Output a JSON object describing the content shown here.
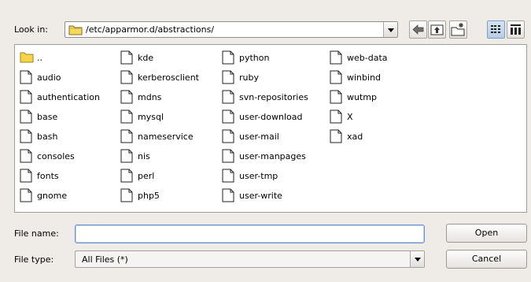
{
  "look_in": {
    "label": "Look in:",
    "path": "/etc/apparmor.d/abstractions/"
  },
  "toolbar": {
    "back": "back-arrow-icon",
    "up": "up-folder-icon",
    "new_folder": "new-folder-icon",
    "list_view": "list-view-icon",
    "detail_view": "detail-view-icon"
  },
  "files": {
    "col1": [
      "..",
      "audio",
      "authentication",
      "base",
      "bash",
      "consoles",
      "fonts",
      "gnome"
    ],
    "col2": [
      "kde",
      "kerberosclient",
      "mdns",
      "mysql",
      "nameservice",
      "nis",
      "perl",
      "php5"
    ],
    "col3": [
      "python",
      "ruby",
      "svn-repositories",
      "user-download",
      "user-mail",
      "user-manpages",
      "user-tmp",
      "user-write"
    ],
    "col4": [
      "web-data",
      "winbind",
      "wutmp",
      "X",
      "xad"
    ]
  },
  "file_name": {
    "label": "File name:",
    "value": ""
  },
  "file_type": {
    "label": "File type:",
    "value": "All Files (*)"
  },
  "buttons": {
    "open": "Open",
    "cancel": "Cancel"
  },
  "colors": {
    "background": "#efebe7",
    "folder": "#f3d44a",
    "focus": "#6e93c7"
  }
}
